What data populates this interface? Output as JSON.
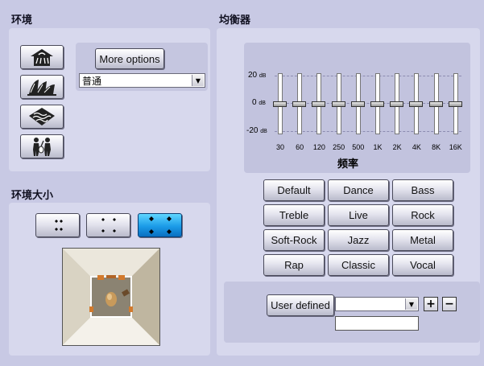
{
  "environment": {
    "title": "环境",
    "buttons": [
      {
        "icon": "house-shower-icon"
      },
      {
        "icon": "opera-house-icon"
      },
      {
        "icon": "wave-terrain-icon"
      },
      {
        "icon": "people-music-icon"
      }
    ],
    "more_options_label": "More options",
    "preset_value": "普通"
  },
  "environment_size": {
    "title": "环境大小",
    "sizes": [
      {
        "icon": "size-small-icon",
        "selected": false
      },
      {
        "icon": "size-medium-icon",
        "selected": false
      },
      {
        "icon": "size-large-icon",
        "selected": true
      }
    ]
  },
  "equalizer": {
    "title": "均衡器",
    "db_labels": {
      "top": "20",
      "mid": "0",
      "bottom": "-20",
      "unit": "dB"
    },
    "bands": [
      "30",
      "60",
      "120",
      "250",
      "500",
      "1K",
      "2K",
      "4K",
      "8K",
      "16K"
    ],
    "band_levels_db": [
      0,
      0,
      0,
      0,
      0,
      0,
      0,
      0,
      0,
      0
    ],
    "freq_label": "频率",
    "presets": [
      "Default",
      "Dance",
      "Bass",
      "Treble",
      "Live",
      "Rock",
      "Soft-Rock",
      "Jazz",
      "Metal",
      "Rap",
      "Classic",
      "Vocal"
    ],
    "user_defined_label": "User defined",
    "user_select_value": "",
    "add_label": "+",
    "remove_label": "−"
  },
  "colors": {
    "background": "#c8c9e4",
    "panel": "#d7d8ed",
    "selected": "#1b9be8"
  }
}
